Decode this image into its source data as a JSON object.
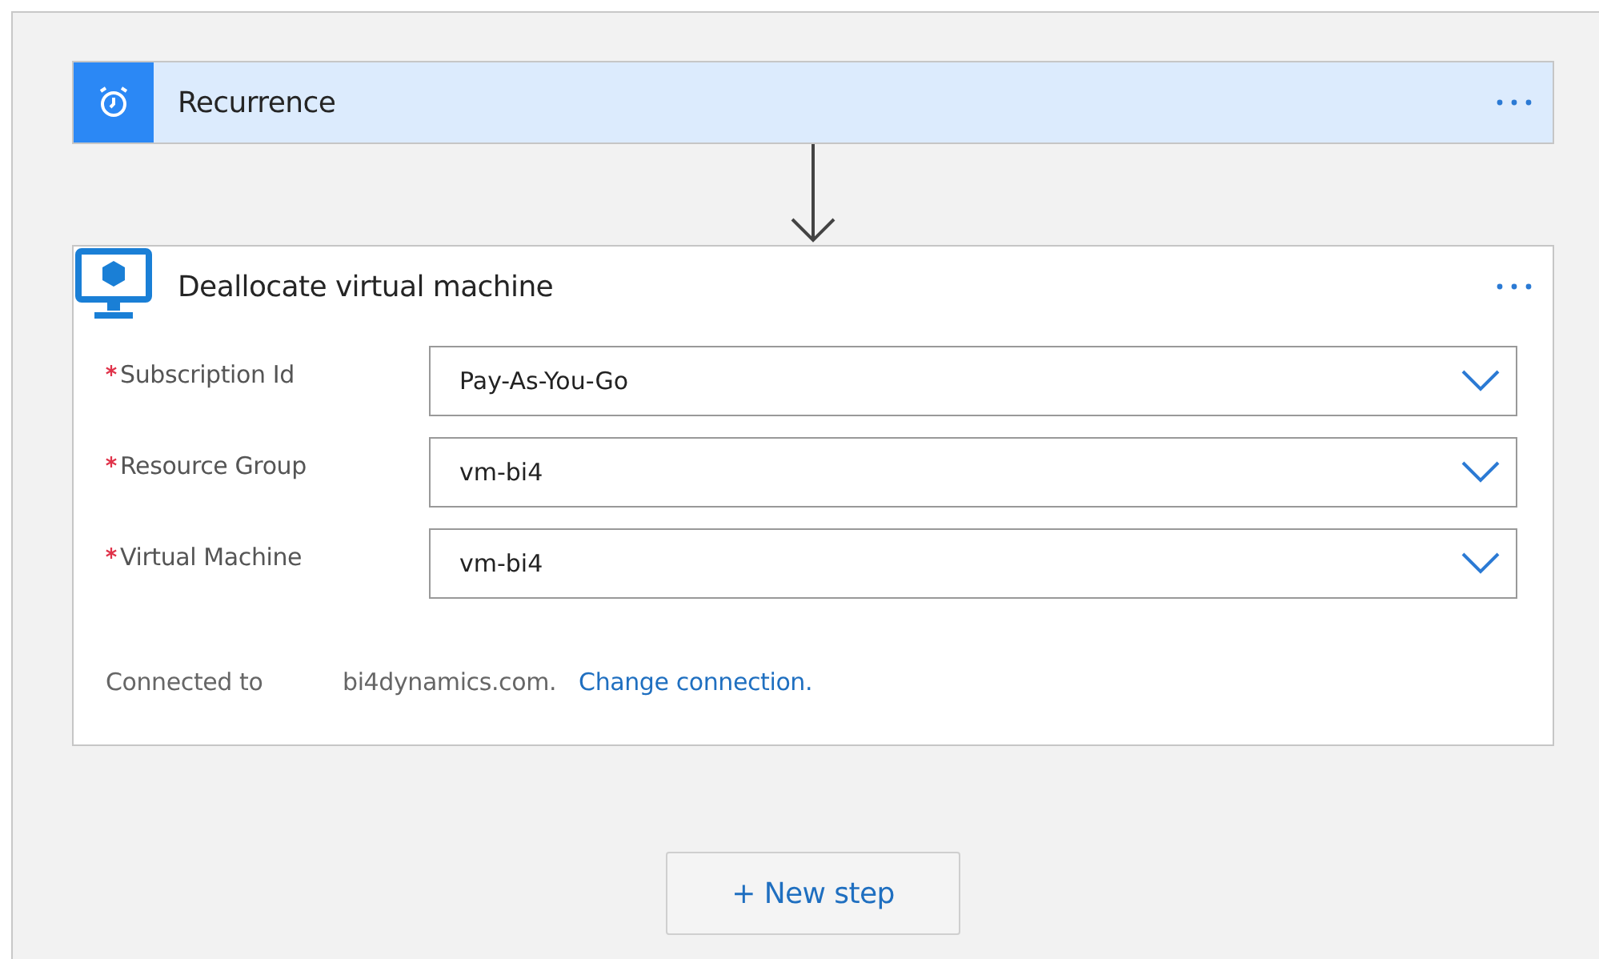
{
  "trigger": {
    "title": "Recurrence"
  },
  "action": {
    "title": "Deallocate virtual machine",
    "fields": [
      {
        "label": "Subscription Id",
        "required": true,
        "value": "Pay-As-You-Go"
      },
      {
        "label": "Resource Group",
        "required": true,
        "value": "vm-bi4"
      },
      {
        "label": "Virtual Machine",
        "required": true,
        "value": "vm-bi4"
      }
    ],
    "connection": {
      "label": "Connected to",
      "account": "bi4dynamics.com.",
      "link": "Change connection."
    }
  },
  "new_step_button": "+ New step"
}
